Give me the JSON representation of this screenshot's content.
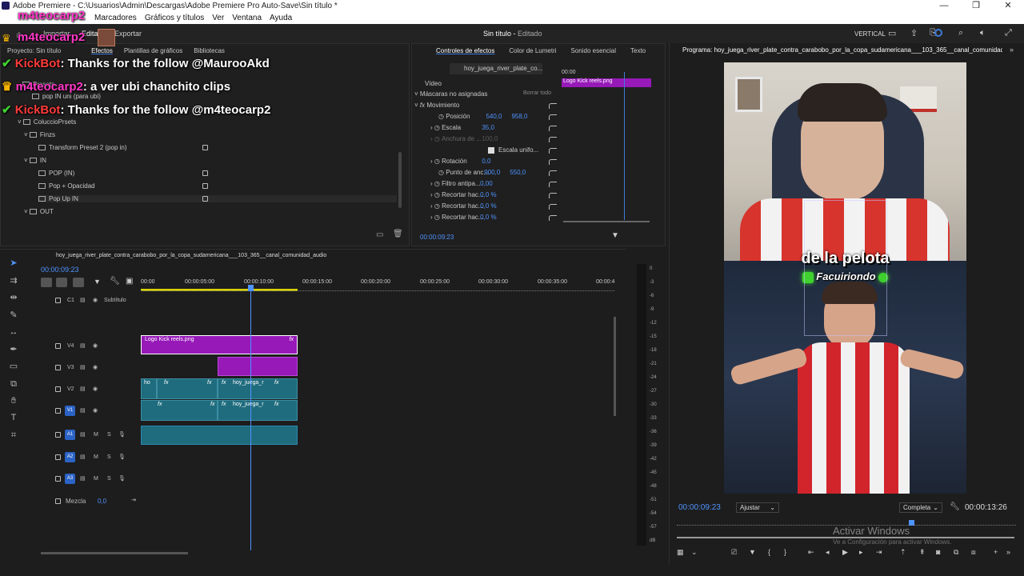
{
  "window": {
    "title": "Adobe Premiere - C:\\Usuarios\\Admin\\Descargas\\Adobe Premiere Pro Auto-Save\\Sin título *",
    "controls": [
      "—",
      "❐",
      "✕"
    ]
  },
  "menubar": {
    "items": [
      "Marcadores",
      "Gráficos y títulos",
      "Ver",
      "Ventana",
      "Ayuda"
    ]
  },
  "workspace": {
    "tabs": [
      "Importar",
      "Editar",
      "Exportar"
    ],
    "project_title": "Sin título",
    "status": "Editado",
    "layout_label": "VERTICAL"
  },
  "chat_overlay": {
    "user1": "m4teocarp2",
    "user2": "m4teocarp2",
    "messages": [
      {
        "name": "KickBot",
        "text": ": Thanks for the follow @MaurooAkd"
      },
      {
        "name": "m4teocarp2",
        "text": ": a ver ubi chanchito clips"
      },
      {
        "name": "KickBot",
        "text": ": Thanks for the follow @m4teocarp2"
      }
    ]
  },
  "project_panel": {
    "tabs": [
      "Proyecto: Sin título",
      "Efectos",
      "Plantillas de gráficos",
      "Bibliotecas"
    ],
    "tree": [
      {
        "label": "Presets",
        "indent": 0
      },
      {
        "label": "pop IN uni (para ubi)",
        "indent": 1
      },
      {
        "label": "ColuccioPrsets",
        "indent": 0
      },
      {
        "label": "Finzs",
        "indent": 1
      },
      {
        "label": "Transform Preset 2 (pop in)",
        "indent": 2
      },
      {
        "label": "IN",
        "indent": 1
      },
      {
        "label": "POP (IN)",
        "indent": 2
      },
      {
        "label": "Pop + Opacidad",
        "indent": 2
      },
      {
        "label": "Pop Up IN",
        "indent": 2
      },
      {
        "label": "OUT",
        "indent": 1
      }
    ]
  },
  "effect_controls": {
    "tabs": [
      "Controles de efectos",
      "Color de Lumetri",
      "Sonido esencial",
      "Texto"
    ],
    "clip_name": "hoy_juega_river_plate_co...",
    "mini_time": "00:00",
    "mini_clip": "Logo Kick reels.png",
    "section": "Vídeo",
    "masks_label": "Máscaras no asignadas",
    "delete_all": "Borrar todo",
    "motion": "Movimiento",
    "props": [
      {
        "name": "Posición",
        "v1": "540,0",
        "v2": "958,0"
      },
      {
        "name": "Escala",
        "v1": "35,0",
        "v2": ""
      },
      {
        "name": "Anchura de ...",
        "v1": "100,0",
        "v2": ""
      },
      {
        "name": "Escala unifo...",
        "v1": "",
        "v2": ""
      },
      {
        "name": "Rotación",
        "v1": "0,0",
        "v2": ""
      },
      {
        "name": "Punto de anc...",
        "v1": "900,0",
        "v2": "550,0"
      },
      {
        "name": "Filtro antipa...",
        "v1": "0,00",
        "v2": ""
      },
      {
        "name": "Recortar hac...",
        "v1": "0,0 %",
        "v2": ""
      },
      {
        "name": "Recortar hac...",
        "v1": "0,0 %",
        "v2": ""
      },
      {
        "name": "Recortar hac...",
        "v1": "0,0 %",
        "v2": ""
      }
    ],
    "timecode": "00:00:09:23"
  },
  "timeline": {
    "sequence_name": "hoy_juega_river_plate_contra_carabobo_por_la_copa_sudamericana___103_365__canal_comunidad_audio",
    "timecode": "00:00:09:23",
    "ruler": [
      "00:00",
      "00:00:05:00",
      "00:00:10:00",
      "00:00:15:00",
      "00:00:20:00",
      "00:00:25:00",
      "00:00:30:00",
      "00:00:35:00",
      "00:00:4"
    ],
    "subtitle_track": "Subtítulo",
    "subtitle_id": "C1",
    "video_tracks": [
      "V4",
      "V3",
      "V2",
      "V1"
    ],
    "audio_tracks": [
      "A1",
      "A2",
      "A3"
    ],
    "mix_label": "Mezcla",
    "mix_value": "0,0",
    "clip_logo": "Logo Kick reels.png",
    "clip_short": "ho",
    "clip_name": "hoy_juega_r",
    "fx": "fx",
    "ms": [
      "M",
      "S"
    ]
  },
  "audio_meter": {
    "ticks": [
      "0",
      "-3",
      "-6",
      "-9",
      "-12",
      "-15",
      "-18",
      "-21",
      "-24",
      "-27",
      "-30",
      "-33",
      "-36",
      "-39",
      "-42",
      "-45",
      "-48",
      "-51",
      "-54",
      "-57",
      "dB"
    ]
  },
  "program_monitor": {
    "title": "Programa: hoy_juega_river_plate_contra_carabobo_por_la_copa_sudamericana___103_365__canal_comunidad_audio",
    "caption_main": "de la pelota",
    "caption_sub": "Facuiriondo",
    "current_time": "00:00:09:23",
    "fit": "Ajustar",
    "quality": "Completa",
    "duration": "00:00:13:26",
    "watermark_title": "Activar Windows",
    "watermark_sub": "Ve a Configuración para activar Windows."
  },
  "colors": {
    "accent": "#3d7bd9",
    "clip_purple": "#9619b8",
    "clip_teal": "#1f6c7e",
    "value_blue": "#4f93ff"
  }
}
